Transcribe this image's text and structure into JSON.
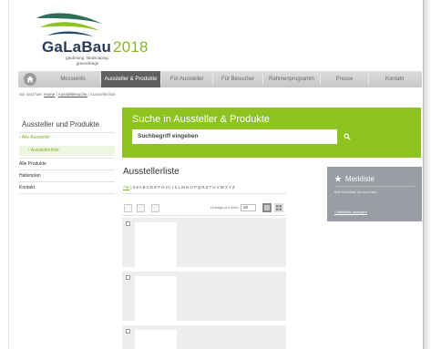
{
  "header": {
    "logo_main": "GaLaBau",
    "logo_year": "2018",
    "logo_tagline": [
      "gardening. landscaping.",
      "greendesign"
    ]
  },
  "nav": {
    "items": [
      {
        "label": "Messeinfo"
      },
      {
        "label": "Aussteller & Produkte",
        "active": true
      },
      {
        "label": "Für Aussteller"
      },
      {
        "label": "Für Besucher"
      },
      {
        "label": "Rahmenprogramm"
      },
      {
        "label": "Presse"
      },
      {
        "label": "Kontakt"
      }
    ]
  },
  "breadcrumb": {
    "prefix": "Sie sind hier:",
    "home": "Home",
    "sep": "|",
    "search": "Ausstellersuche",
    "current": "Ausstellerliste"
  },
  "sidebar": {
    "title": "Aussteller und Produkte",
    "items": [
      {
        "label": "› Alle Aussteller"
      },
      {
        "label": "› Ausstellerliste"
      },
      {
        "label": "Alle Produkte"
      },
      {
        "label": "Hallenplan"
      },
      {
        "label": "Kontakt"
      }
    ]
  },
  "search": {
    "title": "Suche in Aussteller & Produkte",
    "placeholder": "Suchbegriff eingeben"
  },
  "list": {
    "title": "Ausstellerliste",
    "alpha_all": "Alle",
    "alpha_rest": "| 0-9 A B C D E F G H I J K L M N O P Q R S T U V W X Y Z",
    "per_page_label": "Einträge pro Seite:",
    "per_page_value": "20"
  },
  "merkliste": {
    "title": "Merkliste",
    "text": "Ihre Merkliste ist noch leer.",
    "link": "› Merkliste anzeigen"
  },
  "colors": {
    "accent_green": "#8cc31f",
    "nav_active": "#5f5f5f",
    "merk_bg": "#9a9da3",
    "logo_navy": "#2a3b57"
  }
}
